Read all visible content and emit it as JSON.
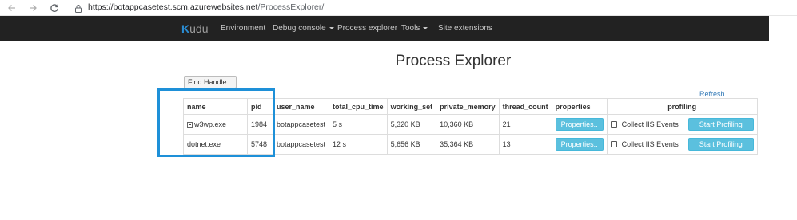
{
  "browser": {
    "url_host": "https://botappcasetest.scm.azurewebsites.net",
    "url_path": "/ProcessExplorer/",
    "icons": [
      "back-arrow-icon",
      "forward-arrow-icon",
      "reload-icon",
      "lock-icon"
    ]
  },
  "navbar": {
    "brand_k": "K",
    "brand_rest": "udu",
    "items": [
      "Environment",
      "Debug console",
      "Process explorer",
      "Tools",
      "Site extensions"
    ]
  },
  "page": {
    "title": "Process Explorer",
    "find_handle": "Find Handle...",
    "refresh": "Refresh"
  },
  "table": {
    "headers": [
      "name",
      "pid",
      "user_name",
      "total_cpu_time",
      "working_set",
      "private_memory",
      "thread_count",
      "properties",
      "profiling"
    ],
    "rows": [
      {
        "name": "w3wp.exe",
        "pid": "1984",
        "user_name": "botappcasetest",
        "total_cpu_time": "5 s",
        "working_set": "5,320 KB",
        "private_memory": "10,360 KB",
        "thread_count": "21",
        "properties_btn": "Properties..",
        "iis_label": "Collect IIS Events",
        "start_btn": "Start Profiling"
      },
      {
        "name": "dotnet.exe",
        "pid": "5748",
        "user_name": "botappcasetest",
        "total_cpu_time": "12 s",
        "working_set": "5,656 KB",
        "private_memory": "35,364 KB",
        "thread_count": "13",
        "properties_btn": "Properties..",
        "iis_label": "Collect IIS Events",
        "start_btn": "Start Profiling"
      }
    ]
  },
  "colors": {
    "navbar_bg": "#222222",
    "brand_accent": "#2a8dd4",
    "info_button": "#5bc0de",
    "highlight_box": "#1e90d8"
  }
}
